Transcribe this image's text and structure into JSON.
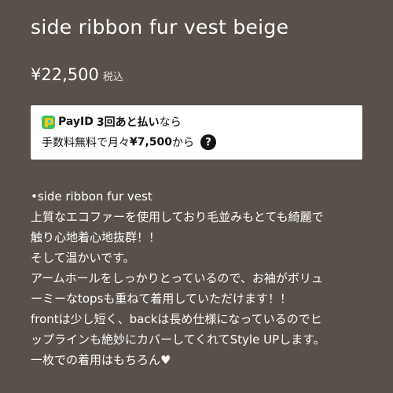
{
  "product": {
    "title": "side ribbon fur vest beige",
    "price": "¥22,500",
    "tax_label": "税込"
  },
  "payid": {
    "brand": "PayID",
    "plan": "3回あと払い",
    "plan_suffix": "なら",
    "line2_prefix": "手数料無料で月々",
    "amount": "¥7,500",
    "line2_suffix": "から",
    "help_icon": "question-circle-icon",
    "logo_icon": "payid-logo-icon",
    "colors": {
      "logo_green": "#3fbf5f",
      "logo_yellow": "#f5c518",
      "logo_cyan": "#25c6d8"
    }
  },
  "description": {
    "lines": [
      "•side ribbon fur vest",
      "上質なエコファーを使用しており毛並みもとても綺麗で",
      "触り心地着心地抜群！！",
      "そして温かいです。",
      "アームホールをしっかりとっているので、お袖がボリュ",
      "ーミーなtopsも重ねて着用していただけます！！",
      "frontは少し短く、backは長め仕様になっているのでヒ",
      "ップラインも絶妙にカバーしてくれてStyle UPします。",
      "一枚での着用はもちろん♥"
    ]
  },
  "theme": {
    "background": "#585049",
    "text": "#ffffff"
  }
}
